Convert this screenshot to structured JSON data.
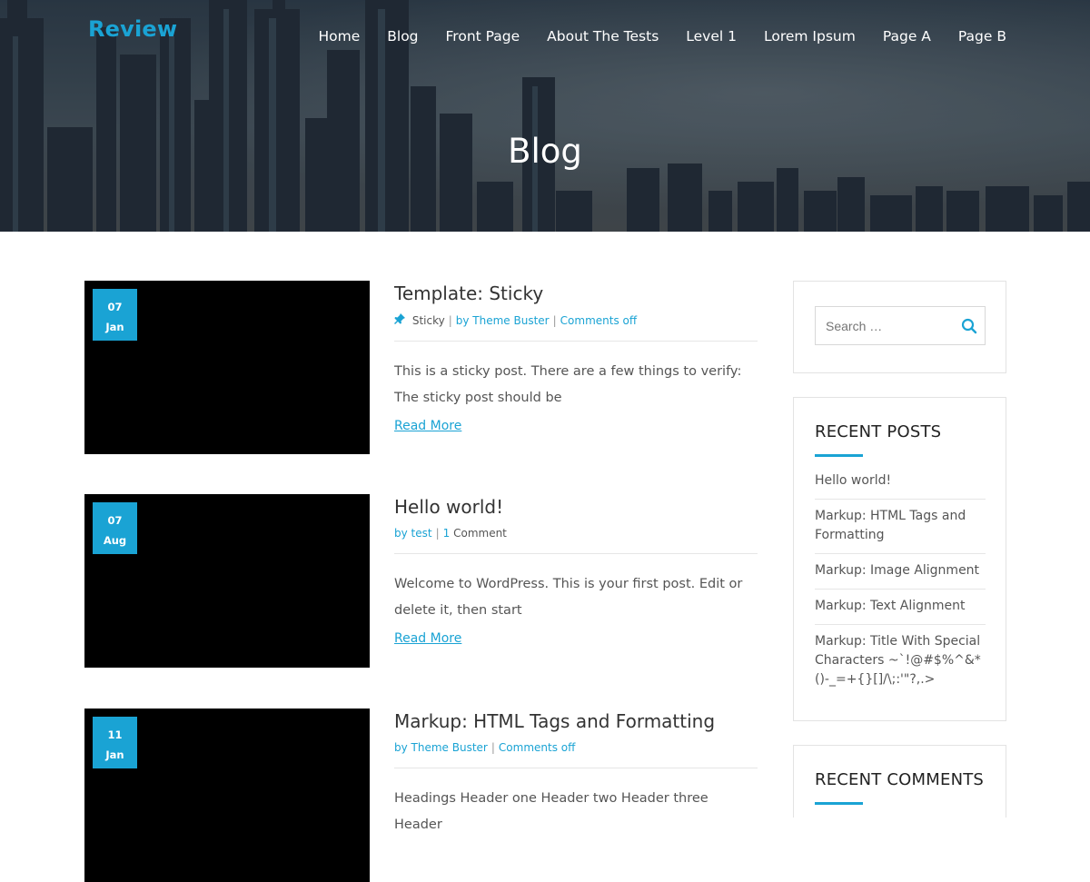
{
  "site": {
    "brand": "Review"
  },
  "nav": {
    "items": [
      {
        "label": "Home"
      },
      {
        "label": "Blog"
      },
      {
        "label": "Front Page"
      },
      {
        "label": "About The Tests"
      },
      {
        "label": "Level 1"
      },
      {
        "label": "Lorem Ipsum"
      },
      {
        "label": "Page A"
      },
      {
        "label": "Page B"
      }
    ]
  },
  "hero": {
    "title": "Blog"
  },
  "posts": [
    {
      "day": "07",
      "month": "Jan",
      "title": "Template: Sticky",
      "sticky_label": "Sticky",
      "author": "by Theme Buster",
      "comments": "Comments off",
      "excerpt": "This is a sticky post. There are a few things to verify: The sticky post should be",
      "read_more": "Read More"
    },
    {
      "day": "07",
      "month": "Aug",
      "title": "Hello world!",
      "author": "by test",
      "comments_count": "1",
      "comments_word": "Comment",
      "excerpt": "Welcome to WordPress. This is your first post. Edit or delete it, then start",
      "read_more": "Read More"
    },
    {
      "day": "11",
      "month": "Jan",
      "title": "Markup: HTML Tags and Formatting",
      "author": "by Theme Buster",
      "comments": "Comments off",
      "excerpt": "Headings Header one Header two Header three Header"
    }
  ],
  "sidebar": {
    "search_placeholder": "Search …",
    "recent_posts_title": "RECENT POSTS",
    "recent_posts": [
      "Hello world!",
      "Markup: HTML Tags and Formatting",
      "Markup: Image Alignment",
      "Markup: Text Alignment",
      "Markup: Title With Special Characters ~`!@#$%^&*()-_=+{}[]/\\;:'\"?,.>"
    ],
    "recent_comments_title": "RECENT COMMENTS"
  },
  "colors": {
    "accent": "#1aa3d4",
    "text": "#555555",
    "heading": "#333333"
  }
}
